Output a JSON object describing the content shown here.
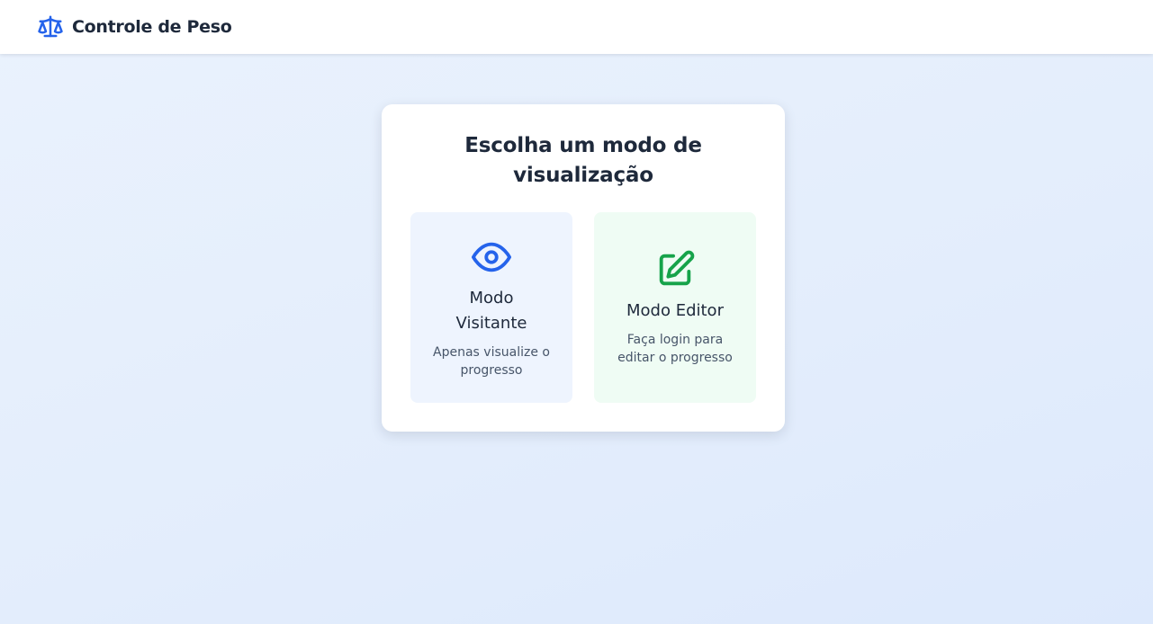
{
  "header": {
    "title": "Controle de Peso",
    "icon": "scale-icon",
    "icon_color": "#2563eb"
  },
  "modal": {
    "title": "Escolha um modo de visualização",
    "options": [
      {
        "title": "Modo Visitante",
        "description": "Apenas visualize o progresso",
        "icon": "eye-icon",
        "icon_color": "#2563eb",
        "background": "#eef4fe"
      },
      {
        "title": "Modo Editor",
        "description": "Faça login para editar o progresso",
        "icon": "edit-icon",
        "icon_color": "#16a34a",
        "background": "#effcf4"
      }
    ]
  }
}
